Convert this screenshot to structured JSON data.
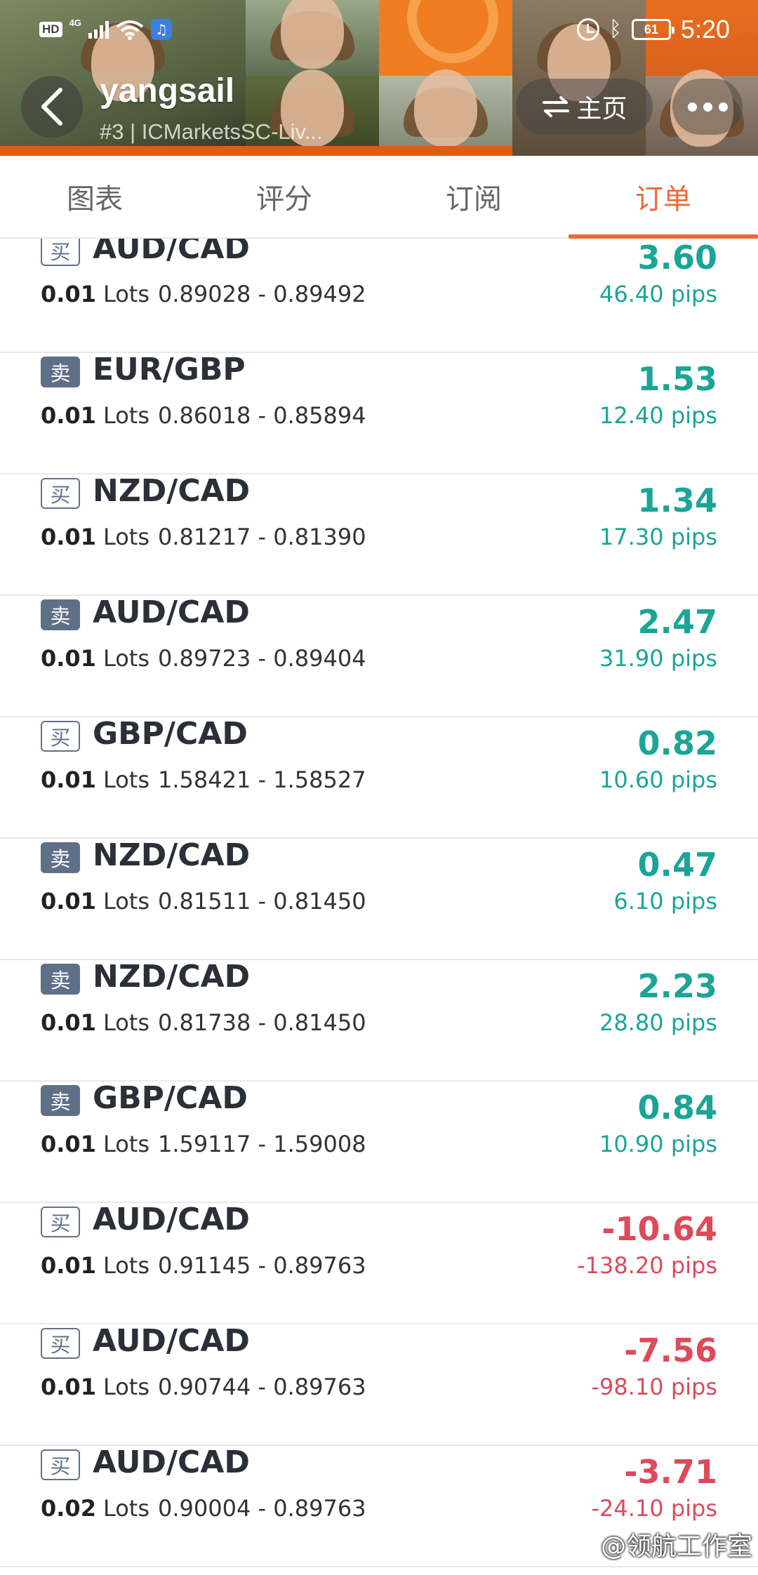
{
  "status_bar": {
    "hd": "HD",
    "network": "4G",
    "battery": "61",
    "time": "5:20"
  },
  "profile": {
    "username": "yangsail",
    "account": "#3 | ICMarketsSC-Liv...",
    "home_label": "主页"
  },
  "tabs": [
    {
      "label": "图表",
      "active": false
    },
    {
      "label": "评分",
      "active": false
    },
    {
      "label": "订阅",
      "active": false
    },
    {
      "label": "订单",
      "active": true
    }
  ],
  "lots_unit": "Lots",
  "orders": [
    {
      "side": "买",
      "type": "buy",
      "pair": "AUD/CAD",
      "lots": "0.01",
      "open": "0.89028",
      "close": "0.89492",
      "profit": "3.60",
      "pips": "46.40 pips",
      "positive": true
    },
    {
      "side": "卖",
      "type": "sell",
      "pair": "EUR/GBP",
      "lots": "0.01",
      "open": "0.86018",
      "close": "0.85894",
      "profit": "1.53",
      "pips": "12.40 pips",
      "positive": true
    },
    {
      "side": "买",
      "type": "buy",
      "pair": "NZD/CAD",
      "lots": "0.01",
      "open": "0.81217",
      "close": "0.81390",
      "profit": "1.34",
      "pips": "17.30 pips",
      "positive": true
    },
    {
      "side": "卖",
      "type": "sell",
      "pair": "AUD/CAD",
      "lots": "0.01",
      "open": "0.89723",
      "close": "0.89404",
      "profit": "2.47",
      "pips": "31.90 pips",
      "positive": true
    },
    {
      "side": "买",
      "type": "buy",
      "pair": "GBP/CAD",
      "lots": "0.01",
      "open": "1.58421",
      "close": "1.58527",
      "profit": "0.82",
      "pips": "10.60 pips",
      "positive": true
    },
    {
      "side": "卖",
      "type": "sell",
      "pair": "NZD/CAD",
      "lots": "0.01",
      "open": "0.81511",
      "close": "0.81450",
      "profit": "0.47",
      "pips": "6.10 pips",
      "positive": true
    },
    {
      "side": "卖",
      "type": "sell",
      "pair": "NZD/CAD",
      "lots": "0.01",
      "open": "0.81738",
      "close": "0.81450",
      "profit": "2.23",
      "pips": "28.80 pips",
      "positive": true
    },
    {
      "side": "卖",
      "type": "sell",
      "pair": "GBP/CAD",
      "lots": "0.01",
      "open": "1.59117",
      "close": "1.59008",
      "profit": "0.84",
      "pips": "10.90 pips",
      "positive": true
    },
    {
      "side": "买",
      "type": "buy",
      "pair": "AUD/CAD",
      "lots": "0.01",
      "open": "0.91145",
      "close": "0.89763",
      "profit": "-10.64",
      "pips": "-138.20 pips",
      "positive": false
    },
    {
      "side": "买",
      "type": "buy",
      "pair": "AUD/CAD",
      "lots": "0.01",
      "open": "0.90744",
      "close": "0.89763",
      "profit": "-7.56",
      "pips": "-98.10 pips",
      "positive": false
    },
    {
      "side": "买",
      "type": "buy",
      "pair": "AUD/CAD",
      "lots": "0.02",
      "open": "0.90004",
      "close": "0.89763",
      "profit": "-3.71",
      "pips": "-24.10 pips",
      "positive": false
    }
  ],
  "colors": {
    "accent": "#ec6a36",
    "profit_positive": "#1aa596",
    "profit_negative": "#dd4a5b"
  },
  "watermark": "@领航工作室"
}
